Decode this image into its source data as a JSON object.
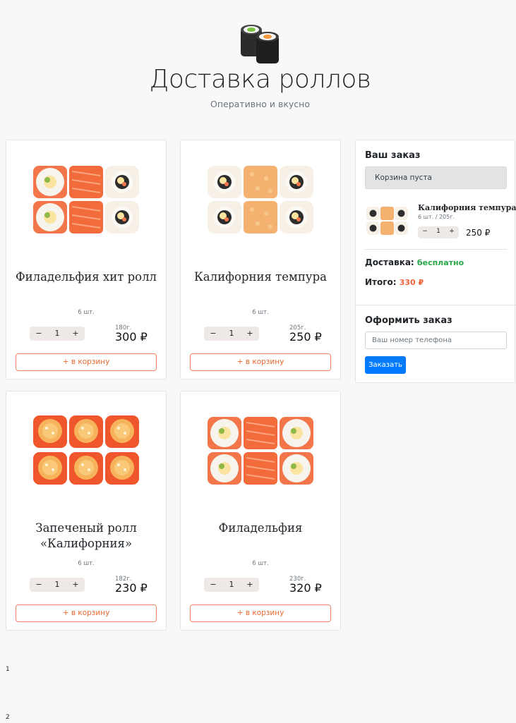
{
  "header": {
    "title": "Доставка роллов",
    "subtitle": "Оперативно и вкусно",
    "logo_icon": "sushi-rolls-logo-icon"
  },
  "products": [
    {
      "title_line1": "Филадельфия хит ролл",
      "title_line2": "",
      "pieces": "6 шт.",
      "qty": "1",
      "weight": "180г.",
      "price": "300 ₽",
      "add_label": "+ в корзину",
      "image": "philadelphia-hit-roll-image"
    },
    {
      "title_line1": "Калифорния темпура",
      "title_line2": "",
      "pieces": "6 шт.",
      "qty": "1",
      "weight": "205г.",
      "price": "250 ₽",
      "add_label": "+ в корзину",
      "image": "california-tempura-image"
    },
    {
      "title_line1": "Запеченый ролл",
      "title_line2": "«Калифорния»",
      "pieces": "6 шт.",
      "qty": "1",
      "weight": "182г.",
      "price": "230 ₽",
      "add_label": "+ в корзину",
      "image": "baked-california-roll-image"
    },
    {
      "title_line1": "Филадельфия",
      "title_line2": "",
      "pieces": "6 шт.",
      "qty": "1",
      "weight": "230г.",
      "price": "320 ₽",
      "add_label": "+ в корзину",
      "image": "philadelphia-image"
    }
  ],
  "stepper": {
    "minus": "−",
    "plus": "+"
  },
  "cart": {
    "heading": "Ваш заказ",
    "empty_text": "Корзина пуста",
    "item": {
      "title": "Калифорния темпура",
      "meta": "6 шт. / 205г.",
      "qty": "1",
      "price": "250 ₽"
    },
    "delivery_label": "Доставка:",
    "delivery_value": "бесплатно",
    "total_label": "Итого:",
    "total_value": "330 ₽"
  },
  "checkout": {
    "heading": "Оформить заказ",
    "phone_placeholder": "Ваш номер телефона",
    "submit_label": "Заказать"
  },
  "pager": [
    "1",
    "2"
  ],
  "colors": {
    "accent": "#f0643c",
    "green": "#28a745",
    "blue": "#007bff"
  }
}
